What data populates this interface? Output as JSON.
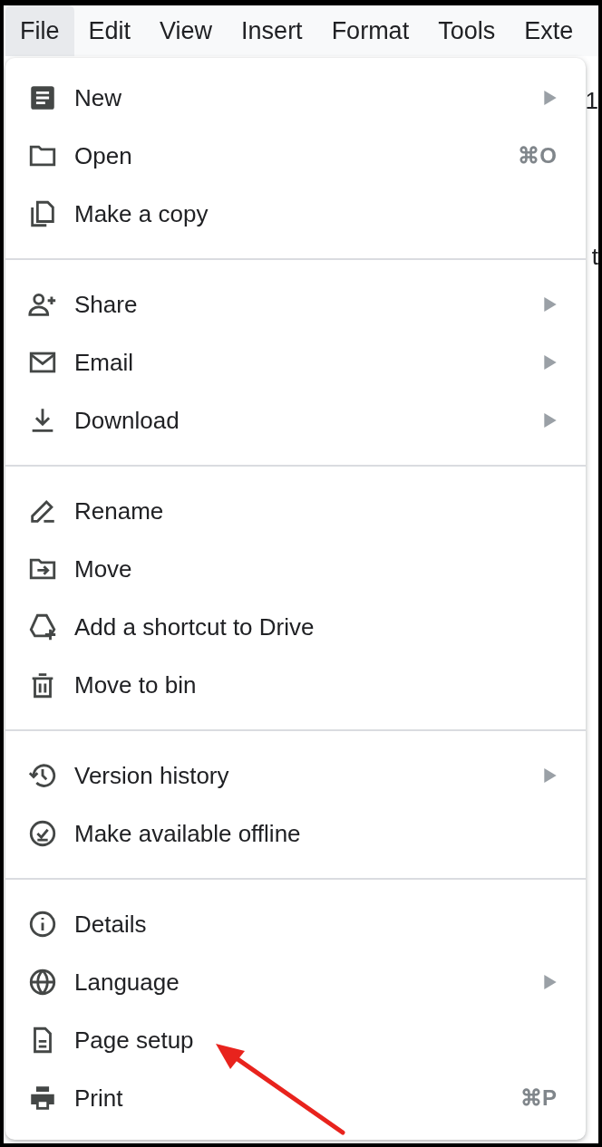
{
  "menu_bar": [
    {
      "label": "File",
      "selected": true
    },
    {
      "label": "Edit",
      "selected": false
    },
    {
      "label": "View",
      "selected": false
    },
    {
      "label": "Insert",
      "selected": false
    },
    {
      "label": "Format",
      "selected": false
    },
    {
      "label": "Tools",
      "selected": false
    },
    {
      "label": "Exte",
      "selected": false
    }
  ],
  "background_fragments": [
    "1",
    "t"
  ],
  "file_menu": [
    [
      {
        "label": "New",
        "submenu": true
      },
      {
        "label": "Open",
        "submenu": false,
        "shortcut": "⌘O"
      },
      {
        "label": "Make a copy",
        "submenu": false
      }
    ],
    [
      {
        "label": "Share",
        "submenu": true
      },
      {
        "label": "Email",
        "submenu": true
      },
      {
        "label": "Download",
        "submenu": true
      }
    ],
    [
      {
        "label": "Rename",
        "submenu": false
      },
      {
        "label": "Move",
        "submenu": false
      },
      {
        "label": "Add a shortcut to Drive",
        "submenu": false
      },
      {
        "label": "Move to bin",
        "submenu": false
      }
    ],
    [
      {
        "label": "Version history",
        "submenu": true
      },
      {
        "label": "Make available offline",
        "submenu": false
      }
    ],
    [
      {
        "label": "Details",
        "submenu": false
      },
      {
        "label": "Language",
        "submenu": true
      },
      {
        "label": "Page setup",
        "submenu": false
      },
      {
        "label": "Print",
        "submenu": false,
        "shortcut": "⌘P"
      }
    ]
  ]
}
